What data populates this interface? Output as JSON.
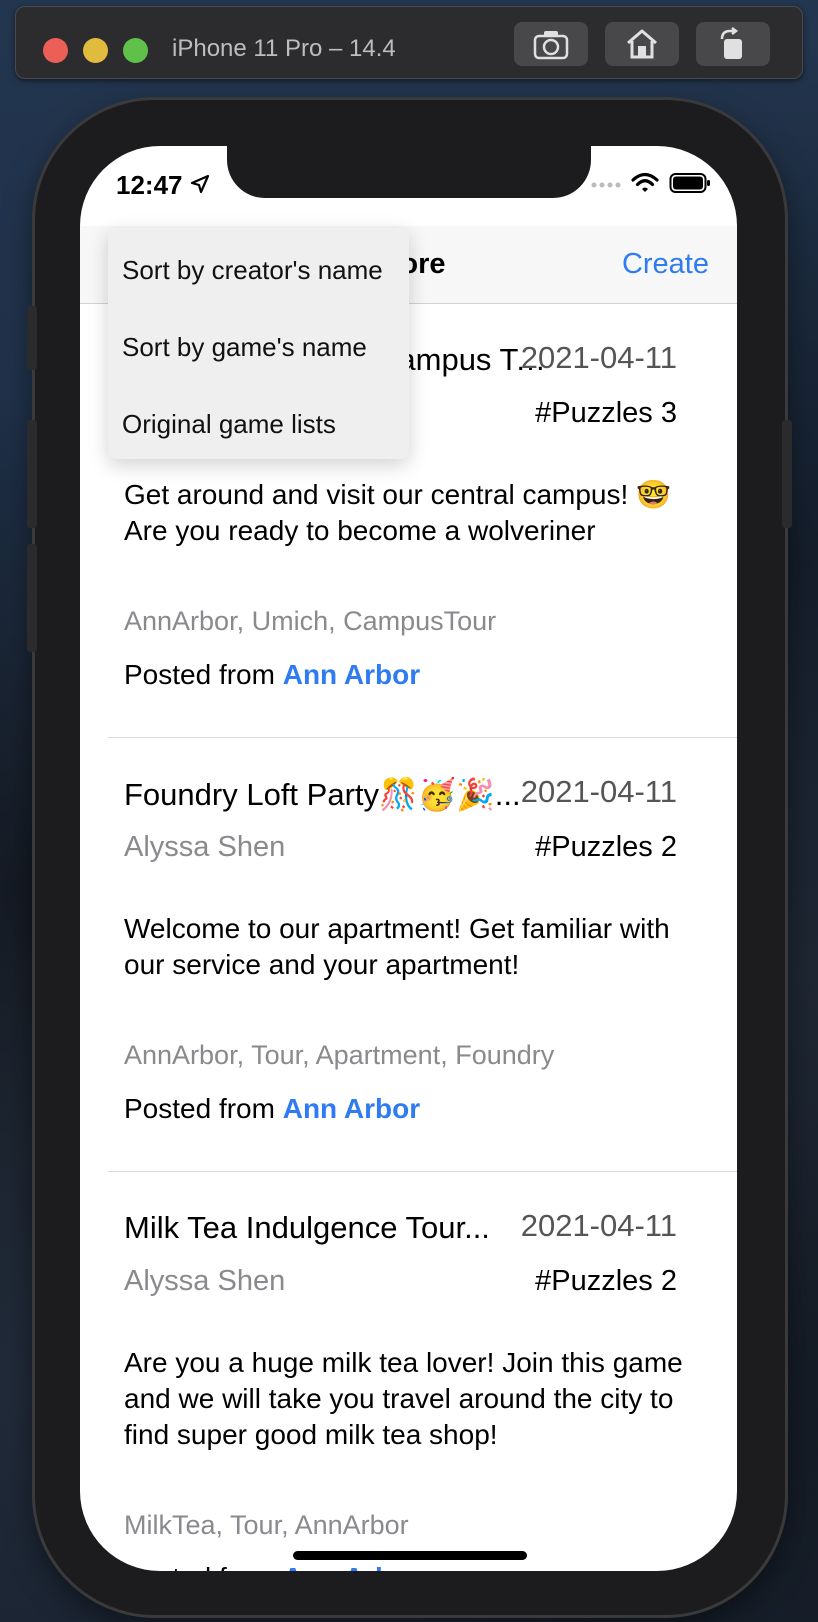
{
  "simulator": {
    "device_title": "iPhone 11 Pro – 14.4",
    "buttons": [
      "screenshot-icon",
      "home-icon",
      "rotate-icon"
    ]
  },
  "status_bar": {
    "time": "12:47"
  },
  "navbar": {
    "title": "Store",
    "create_label": "Create"
  },
  "sort_menu": {
    "items": [
      "Sort by creator's name",
      "Sort by game's name",
      "Original game lists"
    ]
  },
  "games": [
    {
      "title": "Campus To...",
      "date": "2021-04-11",
      "creator": "",
      "puzzles": "#Puzzles 3",
      "description": "Get around and visit our central campus! 🤓Are you ready to become a wolveriner",
      "tags": "AnnArbor, Umich, CampusTour",
      "posted_prefix": "Posted from",
      "location": "Ann Arbor"
    },
    {
      "title": "Foundry Loft Party🎊🥳🎉...",
      "date": "2021-04-11",
      "creator": "Alyssa Shen",
      "puzzles": "#Puzzles 2",
      "description": "Welcome to our apartment! Get familiar with our service and your apartment!",
      "tags": "AnnArbor, Tour, Apartment, Foundry",
      "posted_prefix": "Posted from",
      "location": "Ann Arbor"
    },
    {
      "title": "Milk Tea Indulgence Tour...",
      "date": "2021-04-11",
      "creator": "Alyssa Shen",
      "puzzles": "#Puzzles 2",
      "description": "Are you a huge milk tea lover! Join this game and we will take you travel around the city to find super good milk tea shop!",
      "tags": "MilkTea, Tour, AnnArbor",
      "posted_prefix": "Posted from",
      "location": "Ann Arbor"
    }
  ],
  "colors": {
    "accent": "#2f7bf2",
    "secondary_text": "#8a8a8e"
  }
}
